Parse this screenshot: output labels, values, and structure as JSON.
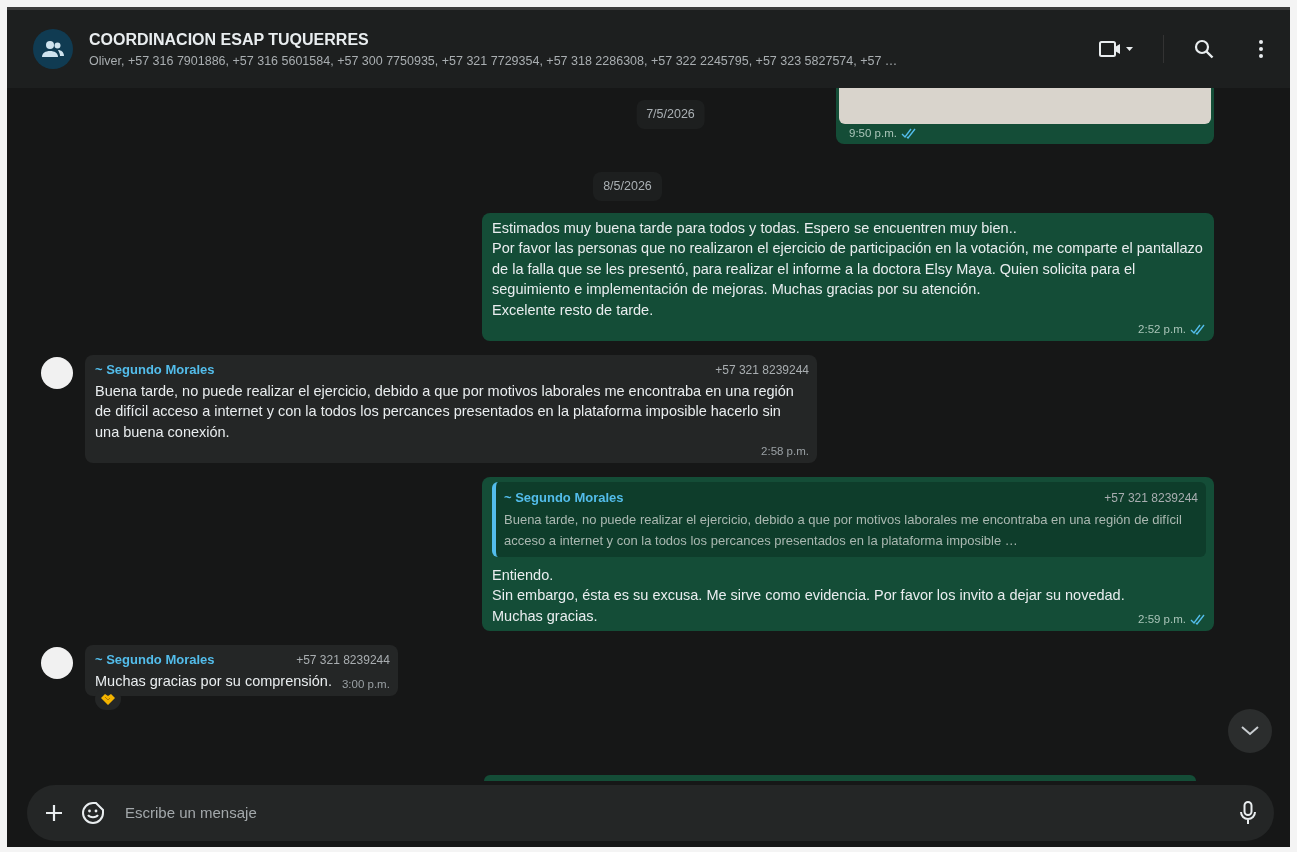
{
  "header": {
    "title": "COORDINACION ESAP TUQUERRES",
    "subtitle": "Oliver, +57 316 7901886, +57 316 5601584, +57 300 7750935, +57 321 7729354, +57 318 2286308, +57 322 2245795, +57 323 5827574, +57 …"
  },
  "floating_date": "7/5/2026",
  "messages": [
    {
      "kind": "image",
      "outgoing": true,
      "time": "9:50 p.m.",
      "read": true
    },
    {
      "kind": "date",
      "text": "8/5/2026"
    },
    {
      "kind": "text",
      "outgoing": true,
      "text": "Estimados muy buena tarde para todos y todas. Espero se encuentren muy bien..\nPor favor las personas que no realizaron el ejercicio de participación en la votación, me comparte el pantallazo de la falla que se les presentó, para realizar el informe a la doctora Elsy Maya. Quien solicita para el seguimiento e implementación de mejoras. Muchas gracias por su atención.\nExcelente resto de tarde.",
      "time": "2:52 p.m.",
      "read": true
    },
    {
      "kind": "text",
      "outgoing": false,
      "sender": "~ Segundo Morales",
      "phone": "+57 321 8239244",
      "text": "Buena tarde, no puede realizar el ejercicio, debido a que por motivos laborales me encontraba en una región de difícil acceso a internet y con la todos los percances presentados en la plataforma imposible hacerlo sin una buena conexión.",
      "time": "2:58 p.m.",
      "reacted": false
    },
    {
      "kind": "reply",
      "outgoing": true,
      "quote": {
        "sender": "~ Segundo Morales",
        "phone": "+57 321 8239244",
        "text": "Buena tarde, no puede realizar el ejercicio, debido a que por motivos laborales me encontraba en una región de difícil acceso a internet y con la todos los percances presentados en la plataforma imposible …"
      },
      "text": "Entiendo.\nSin embargo, ésta es su excusa. Me sirve como evidencia. Por favor los invito a dejar su novedad.\nMuchas gracias.",
      "time": "2:59 p.m.",
      "read": true
    },
    {
      "kind": "text",
      "outgoing": false,
      "sender": "~ Segundo Morales",
      "phone": "+57 321 8239244",
      "text": "Muchas gracias por su comprensión.",
      "time": "3:00 p.m.",
      "reacted": true
    },
    {
      "kind": "partial",
      "outgoing": true
    }
  ],
  "composer": {
    "placeholder": "Escribe un mensaje"
  }
}
